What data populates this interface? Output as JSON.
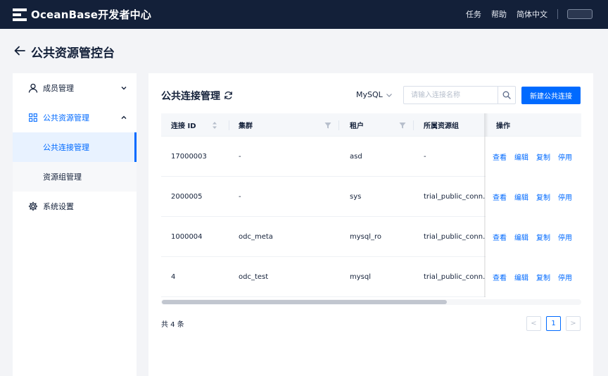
{
  "topbar": {
    "brand": "OceanBase开发者中心",
    "links": [
      "任务",
      "帮助",
      "简体中文"
    ]
  },
  "page": {
    "title": "公共资源管控台"
  },
  "sidebar": {
    "items": [
      {
        "label": "成员管理",
        "icon": "user-icon",
        "chevron": "down"
      },
      {
        "label": "公共资源管理",
        "icon": "grid-icon",
        "chevron": "up"
      },
      {
        "label": "系统设置",
        "icon": "gear-icon"
      }
    ],
    "sub_items": [
      {
        "label": "公共连接管理",
        "selected": true
      },
      {
        "label": "资源组管理",
        "selected": false
      }
    ]
  },
  "card": {
    "title": "公共连接管理",
    "db_type": "MySQL",
    "search_placeholder": "请输入连接名称",
    "new_button": "新建公共连接"
  },
  "table": {
    "columns": [
      "连接 ID",
      "集群",
      "租户",
      "所属资源组",
      "操作"
    ],
    "rows": [
      {
        "id": "17000003",
        "cluster": "-",
        "tenant": "asd",
        "group": "-"
      },
      {
        "id": "2000005",
        "cluster": "-",
        "tenant": "sys",
        "group": "trial_public_conn..."
      },
      {
        "id": "1000004",
        "cluster": "odc_meta",
        "tenant": "mysql_ro",
        "group": "trial_public_conn..."
      },
      {
        "id": "4",
        "cluster": "odc_test",
        "tenant": "mysql",
        "group": "trial_public_conn..."
      }
    ],
    "actions": [
      "查看",
      "编辑",
      "复制",
      "停用"
    ]
  },
  "pagination": {
    "total_text": "共 4 条",
    "current_page": "1",
    "prev": "<",
    "next": ">"
  },
  "colors": {
    "primary": "#006aff",
    "topbar": "#132039"
  }
}
